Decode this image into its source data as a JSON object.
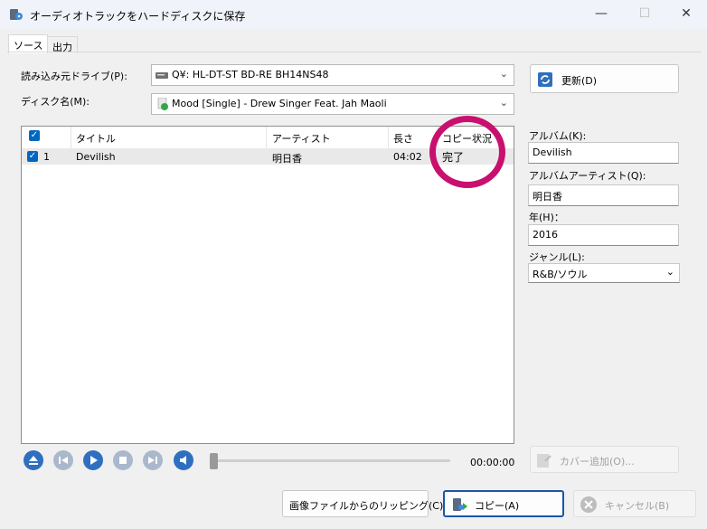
{
  "window": {
    "title": "オーディオトラックをハードディスクに保存",
    "minimize_glyph": "—",
    "maximize_glyph": "☐",
    "close_glyph": "✕"
  },
  "tabs": [
    {
      "label": "ソース",
      "active": true
    },
    {
      "label": "出力",
      "active": false
    }
  ],
  "source": {
    "drive_label": "読み込み元ドライブ(P):",
    "drive_value": "Q¥: HL-DT-ST BD-RE  BH14NS48",
    "disc_label": "ディスク名(M):",
    "disc_value": "Mood [Single] - Drew Singer Feat. Jah Maoli",
    "refresh_label": "更新(D)"
  },
  "tracklist": {
    "columns": [
      "タイトル",
      "アーティスト",
      "長さ",
      "コピー状況"
    ],
    "rows": [
      {
        "num": "1",
        "title": "Devilish",
        "artist": "明日香",
        "length": "04:02",
        "status": "完了",
        "checked": true
      }
    ]
  },
  "metadata": {
    "album_label": "アルバム(K):",
    "album_value": "Devilish",
    "album_artist_label": "アルバムアーティスト(Q):",
    "album_artist_value": "明日香",
    "year_label": "年(H)：",
    "year_value": "2016",
    "genre_label": "ジャンル(L):",
    "genre_value": "R&B/ソウル",
    "cover_button_label": "カバー追加(O)..."
  },
  "player": {
    "time": "00:00:00"
  },
  "footer": {
    "rip_image_label": "画像ファイルからのリッピング(C)",
    "copy_label": "コピー(A)",
    "cancel_label": "キャンセル(B)"
  },
  "colors": {
    "accent": "#0067c0",
    "highlight_circle": "#c8106e"
  }
}
